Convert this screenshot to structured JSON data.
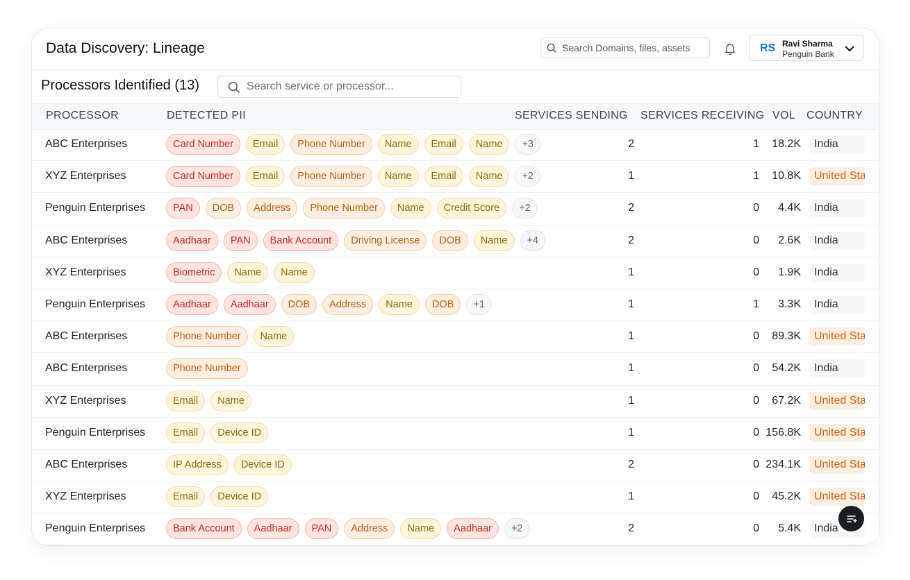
{
  "header": {
    "title": "Data Discovery: Lineage",
    "search_placeholder": "Search Domains, files, assets",
    "user": {
      "initials": "RS",
      "name": "Ravi Sharma",
      "org": "Penguin Bank"
    }
  },
  "section": {
    "title": "Processors Identified (13)",
    "search_placeholder": "Search service or processor..."
  },
  "columns": {
    "processor": "PROCESSOR",
    "pii": "DETECTED PII",
    "sending": "SERVICES SENDING",
    "receiving": "SERVICES RECEIVING",
    "vol": "VOL",
    "country": "COUNTRY"
  },
  "colors": {
    "accent": "#1a73b8",
    "tag_red": "#fde4e1",
    "tag_orange": "#fdeee2",
    "tag_yellow": "#fff5dc",
    "country_us": "#d06312"
  },
  "rows": [
    {
      "processor": "ABC Enterprises",
      "pii": [
        [
          "Card Number",
          "red"
        ],
        [
          "Email",
          "yellow"
        ],
        [
          "Phone Number",
          "orange"
        ],
        [
          "Name",
          "yellow"
        ],
        [
          "Email",
          "yellow"
        ],
        [
          "Name",
          "yellow"
        ],
        [
          "+3",
          "more"
        ]
      ],
      "sending": "2",
      "receiving": "1",
      "vol": "18.2K",
      "country": "India"
    },
    {
      "processor": "XYZ Enterprises",
      "pii": [
        [
          "Card Number",
          "red"
        ],
        [
          "Email",
          "yellow"
        ],
        [
          "Phone Number",
          "orange"
        ],
        [
          "Name",
          "yellow"
        ],
        [
          "Email",
          "yellow"
        ],
        [
          "Name",
          "yellow"
        ],
        [
          "+2",
          "more"
        ]
      ],
      "sending": "1",
      "receiving": "1",
      "vol": "10.8K",
      "country": "United States"
    },
    {
      "processor": "Penguin Enterprises",
      "pii": [
        [
          "PAN",
          "red"
        ],
        [
          "DOB",
          "orange"
        ],
        [
          "Address",
          "orange"
        ],
        [
          "Phone Number",
          "orange"
        ],
        [
          "Name",
          "yellow"
        ],
        [
          "Credit Score",
          "yellow"
        ],
        [
          "+2",
          "more"
        ]
      ],
      "sending": "2",
      "receiving": "0",
      "vol": "4.4K",
      "country": "India"
    },
    {
      "processor": "ABC Enterprises",
      "pii": [
        [
          "Aadhaar",
          "red"
        ],
        [
          "PAN",
          "red"
        ],
        [
          "Bank Account",
          "red"
        ],
        [
          "Driving License",
          "orange"
        ],
        [
          "DOB",
          "orange"
        ],
        [
          "Name",
          "yellow"
        ],
        [
          "+4",
          "more"
        ]
      ],
      "sending": "2",
      "receiving": "0",
      "vol": "2.6K",
      "country": "India"
    },
    {
      "processor": "XYZ Enterprises",
      "pii": [
        [
          "Biometric",
          "red"
        ],
        [
          "Name",
          "yellow"
        ],
        [
          "Name",
          "yellow"
        ]
      ],
      "sending": "1",
      "receiving": "0",
      "vol": "1.9K",
      "country": "India"
    },
    {
      "processor": "Penguin Enterprises",
      "pii": [
        [
          "Aadhaar",
          "red"
        ],
        [
          "Aadhaar",
          "red"
        ],
        [
          "DOB",
          "orange"
        ],
        [
          "Address",
          "orange"
        ],
        [
          "Name",
          "yellow"
        ],
        [
          "DOB",
          "orange"
        ],
        [
          "+1",
          "more"
        ]
      ],
      "sending": "1",
      "receiving": "1",
      "vol": "3.3K",
      "country": "India"
    },
    {
      "processor": "ABC Enterprises",
      "pii": [
        [
          "Phone Number",
          "orange"
        ],
        [
          "Name",
          "yellow"
        ]
      ],
      "sending": "1",
      "receiving": "0",
      "vol": "89.3K",
      "country": "United States"
    },
    {
      "processor": "ABC Enterprises",
      "pii": [
        [
          "Phone Number",
          "orange"
        ]
      ],
      "sending": "1",
      "receiving": "0",
      "vol": "54.2K",
      "country": "India"
    },
    {
      "processor": "XYZ Enterprises",
      "pii": [
        [
          "Email",
          "yellow"
        ],
        [
          "Name",
          "yellow"
        ]
      ],
      "sending": "1",
      "receiving": "0",
      "vol": "67.2K",
      "country": "United States"
    },
    {
      "processor": "Penguin Enterprises",
      "pii": [
        [
          "Email",
          "yellow"
        ],
        [
          "Device ID",
          "yellow"
        ]
      ],
      "sending": "1",
      "receiving": "0",
      "vol": "156.8K",
      "country": "United States"
    },
    {
      "processor": "ABC Enterprises",
      "pii": [
        [
          "IP Address",
          "yellow"
        ],
        [
          "Device ID",
          "yellow"
        ]
      ],
      "sending": "2",
      "receiving": "0",
      "vol": "234.1K",
      "country": "United States"
    },
    {
      "processor": "XYZ Enterprises",
      "pii": [
        [
          "Email",
          "yellow"
        ],
        [
          "Device ID",
          "yellow"
        ]
      ],
      "sending": "1",
      "receiving": "0",
      "vol": "45.2K",
      "country": "United States"
    },
    {
      "processor": "Penguin Enterprises",
      "pii": [
        [
          "Bank Account",
          "red"
        ],
        [
          "Aadhaar",
          "red"
        ],
        [
          "PAN",
          "red"
        ],
        [
          "Address",
          "orange"
        ],
        [
          "Name",
          "yellow"
        ],
        [
          "Aadhaar",
          "red"
        ],
        [
          "+2",
          "more"
        ]
      ],
      "sending": "2",
      "receiving": "0",
      "vol": "5.4K",
      "country": "India"
    }
  ]
}
